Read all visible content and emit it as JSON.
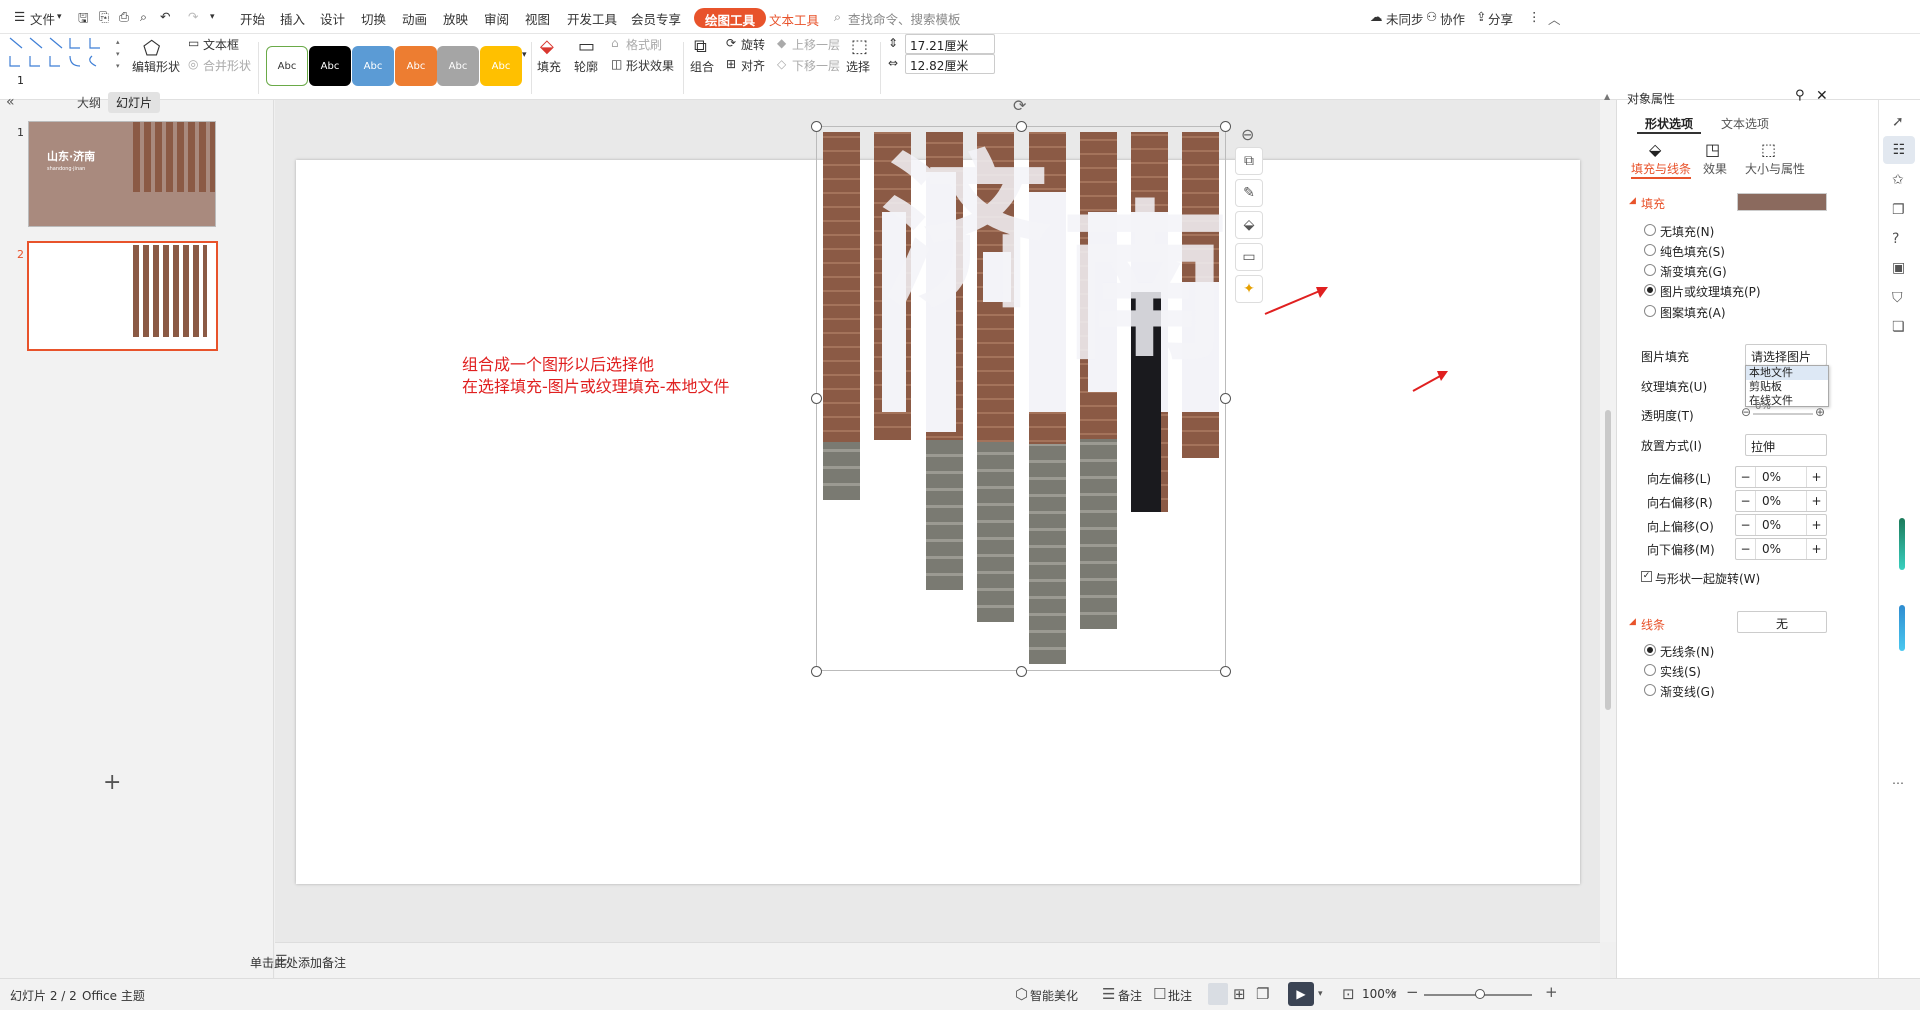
{
  "menu": {
    "file": "文件",
    "tabs": [
      "开始",
      "插入",
      "设计",
      "切换",
      "动画",
      "放映",
      "审阅",
      "视图",
      "开发工具",
      "会员专享"
    ],
    "drawing_tools": "绘图工具",
    "text_tools": "文本工具",
    "search_placeholder": "查找命令、搜索模板",
    "unsync": "未同步",
    "collab": "协作",
    "share": "分享"
  },
  "ribbon": {
    "edit_shape": "编辑形状",
    "textbox": "文本框",
    "merge_shape": "合并形状",
    "style_label": "Abc",
    "fill": "填充",
    "outline": "轮廓",
    "format_brush": "格式刷",
    "shape_effect": "形状效果",
    "rotate": "旋转",
    "group": "组合",
    "align": "对齐",
    "bring_forward": "上移一层",
    "send_backward": "下移一层",
    "select": "选择",
    "height_value": "17.21厘米",
    "width_value": "12.82厘米"
  },
  "left_panel": {
    "tab_outline": "大纲",
    "tab_slides": "幻灯片",
    "slide1_num": "1",
    "slide2_num": "2",
    "slide1_title": "山东·济南",
    "slide1_sub": "shandong·jinan"
  },
  "slide": {
    "annotation_line1": "组合成一个图形以后选择他",
    "annotation_line2": "在选择填充-图片或纹理填充-本地文件",
    "char1": "济",
    "char2": "南"
  },
  "notes": {
    "placeholder": "单击此处添加备注"
  },
  "props": {
    "title": "对象属性",
    "tab_shape": "形状选项",
    "tab_text": "文本选项",
    "sub_fill_line": "填充与线条",
    "sub_effect": "效果",
    "sub_size": "大小与属性",
    "fill_heading": "填充",
    "fill_options": [
      "无填充(N)",
      "纯色填充(S)",
      "渐变填充(G)",
      "图片或纹理填充(P)",
      "图案填充(A)"
    ],
    "picture_fill_label": "图片填充",
    "picture_fill_value": "请选择图片",
    "dropdown_options": [
      "本地文件",
      "剪贴板",
      "在线文件"
    ],
    "texture_label": "纹理填充(U)",
    "transparency_label": "透明度(T)",
    "transparency_value": "0%",
    "placement_label": "放置方式(I)",
    "placement_value": "拉伸",
    "offset_left": "向左偏移(L)",
    "offset_right": "向右偏移(R)",
    "offset_top": "向上偏移(O)",
    "offset_bottom": "向下偏移(M)",
    "offset_value": "0%",
    "rotate_with_shape": "与形状一起旋转(W)",
    "line_heading": "线条",
    "line_value": "无",
    "line_options": [
      "无线条(N)",
      "实线(S)",
      "渐变线(G)"
    ]
  },
  "status": {
    "slide_count": "幻灯片 2 / 2",
    "theme": "Office 主题",
    "smart_beautify": "智能美化",
    "notes": "备注",
    "comment": "批注",
    "zoom": "100%"
  },
  "colors": {
    "accent": "#e8532b",
    "brand_red": "#d9372f",
    "annotation_red": "#e02020"
  }
}
